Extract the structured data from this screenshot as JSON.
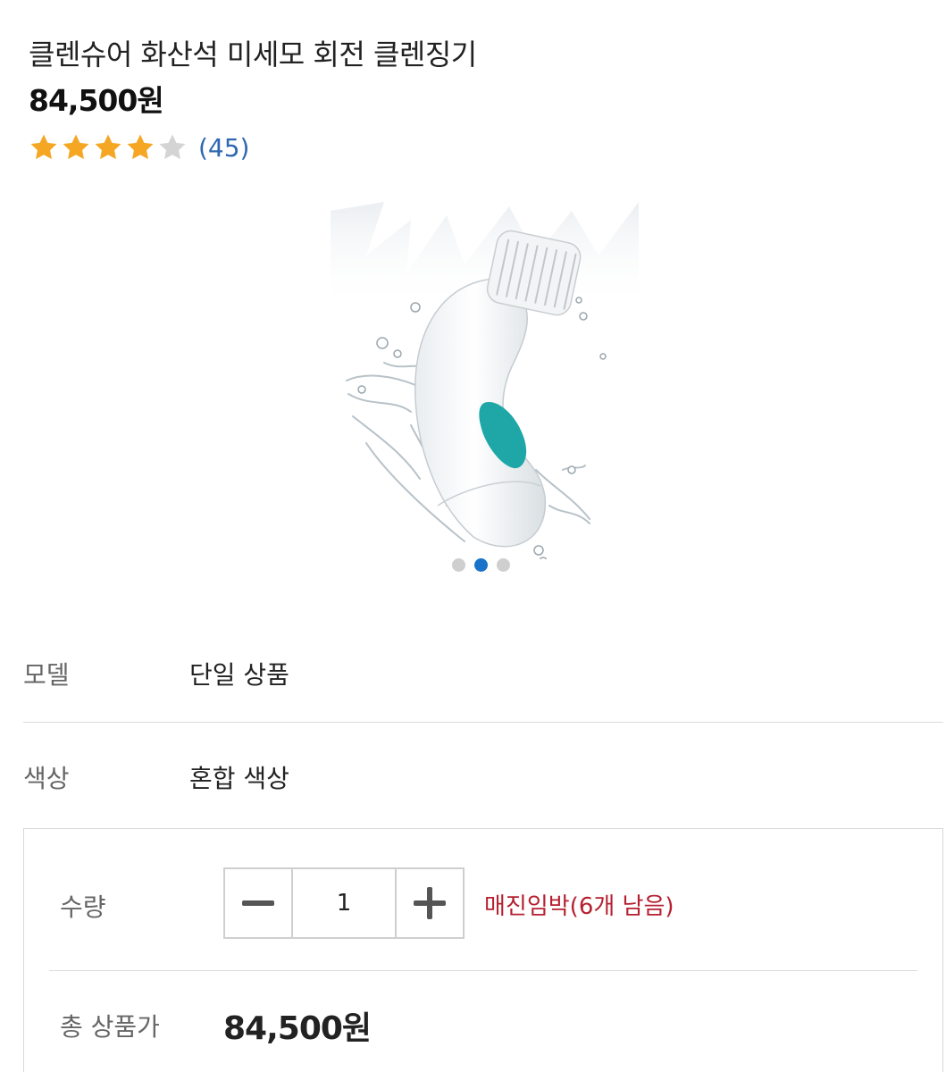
{
  "product": {
    "title": "클렌슈어 화산석 미세모 회전 클렌징기",
    "price": "84,500원",
    "rating": {
      "value": 4,
      "max": 5,
      "review_count": "(45)"
    },
    "image": {
      "icon": "facial-cleansing-brush-with-water-splash",
      "slide_index": 2,
      "slide_count": 3
    }
  },
  "options": [
    {
      "label": "모델",
      "value": "단일 상품"
    },
    {
      "label": "색상",
      "value": "혼합 색상"
    }
  ],
  "order": {
    "quantity_label": "수량",
    "quantity": "1",
    "stock_note": "매진임박(6개 남음)",
    "total_label": "총 상품가",
    "total_price": "84,500원"
  },
  "colors": {
    "star_filled": "#f5a623",
    "star_empty": "#d4d4d4",
    "review_count": "#2f67b2",
    "stock_note": "#b62030",
    "active_dot": "#1a73c8",
    "accent_teal": "#1fa7a8"
  }
}
